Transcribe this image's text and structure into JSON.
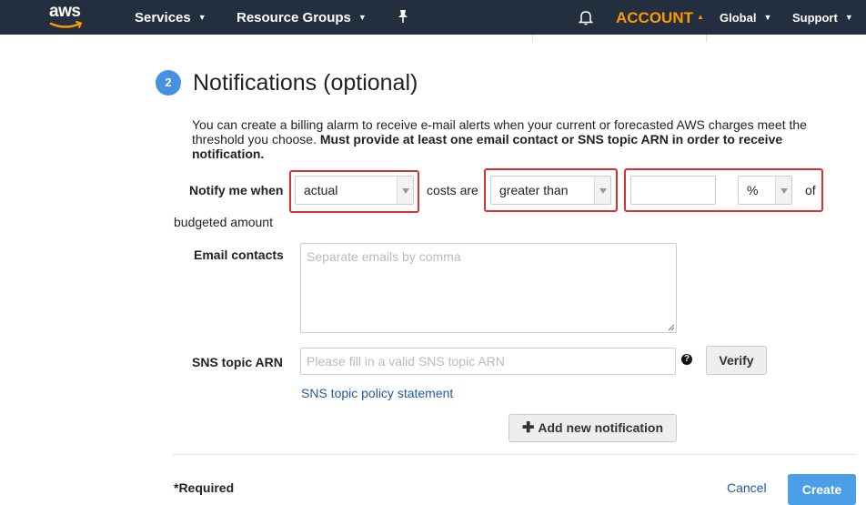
{
  "nav": {
    "logo_text": "aws",
    "services": "Services",
    "resource_groups": "Resource Groups",
    "account": "ACCOUNT",
    "region": "Global",
    "support": "Support"
  },
  "step": {
    "number": "2",
    "title": "Notifications (optional)",
    "description_plain": "You can create a billing alarm to receive e-mail alerts when your current or forecasted AWS charges meet the threshold you choose.",
    "description_bold": "Must provide at least one email contact or SNS topic ARN in order to receive notification."
  },
  "notify": {
    "label": "Notify me when",
    "cost_type": "actual",
    "costs_are": "costs are",
    "comparison": "greater than",
    "threshold_value": "",
    "threshold_unit": "%",
    "of": "of",
    "budgeted_amount": "budgeted amount"
  },
  "email": {
    "label": "Email contacts",
    "placeholder": "Separate emails by comma",
    "value": ""
  },
  "sns": {
    "label": "SNS topic ARN",
    "placeholder": "Please fill in a valid SNS topic ARN",
    "value": "",
    "help": "?",
    "verify": "Verify",
    "policy_link": "SNS topic policy statement"
  },
  "add_notification": "Add new notification",
  "footer": {
    "required": "*Required",
    "cancel": "Cancel",
    "create": "Create"
  },
  "colors": {
    "nav_bg": "#232f3e",
    "account": "#ff9900",
    "highlight": "#d9312f",
    "primary": "#4a9fe8",
    "link": "#1f5b9e"
  }
}
